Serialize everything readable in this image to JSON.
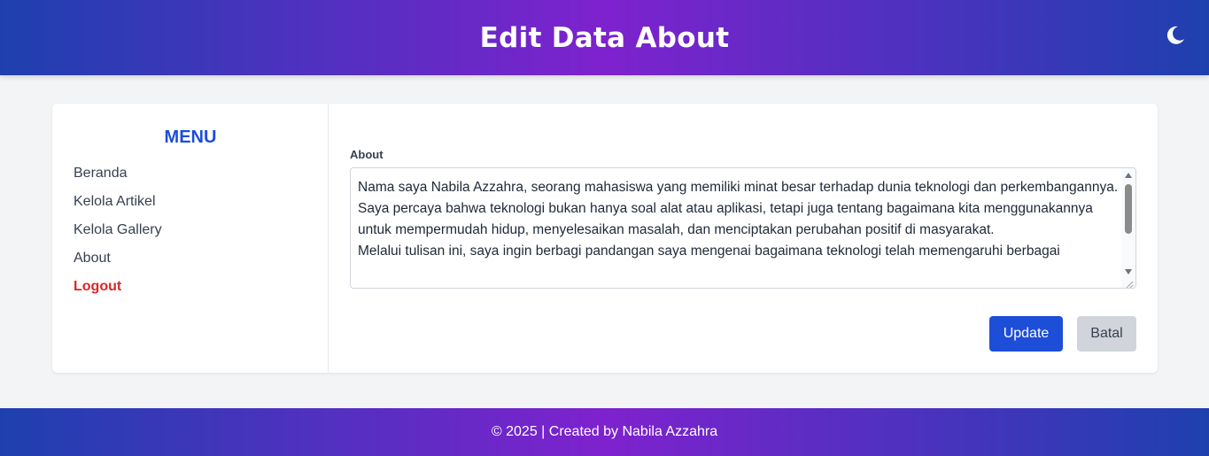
{
  "header": {
    "title": "Edit Data About",
    "theme_toggle_icon": "moon-icon"
  },
  "sidebar": {
    "title": "MENU",
    "items": [
      {
        "label": "Beranda"
      },
      {
        "label": "Kelola Artikel"
      },
      {
        "label": "Kelola Gallery"
      },
      {
        "label": "About"
      },
      {
        "label": "Logout"
      }
    ]
  },
  "form": {
    "about_label": "About",
    "about_value": "Nama saya Nabila Azzahra, seorang mahasiswa yang memiliki minat besar terhadap dunia teknologi dan perkembangannya. Saya percaya bahwa teknologi bukan hanya soal alat atau aplikasi, tetapi juga tentang bagaimana kita menggunakannya untuk mempermudah hidup, menyelesaikan masalah, dan menciptakan perubahan positif di masyarakat.\nMelalui tulisan ini, saya ingin berbagi pandangan saya mengenai bagaimana teknologi telah memengaruhi berbagai",
    "update_label": "Update",
    "cancel_label": "Batal"
  },
  "footer": {
    "text": "© 2025 | Created by Nabila Azzahra"
  },
  "colors": {
    "header_gradient_start": "#1e40af",
    "header_gradient_mid": "#7e22ce",
    "menu_title": "#1d4ed8",
    "logout": "#dc2626",
    "update_button": "#1d4ed8",
    "cancel_button": "#d1d5db"
  }
}
